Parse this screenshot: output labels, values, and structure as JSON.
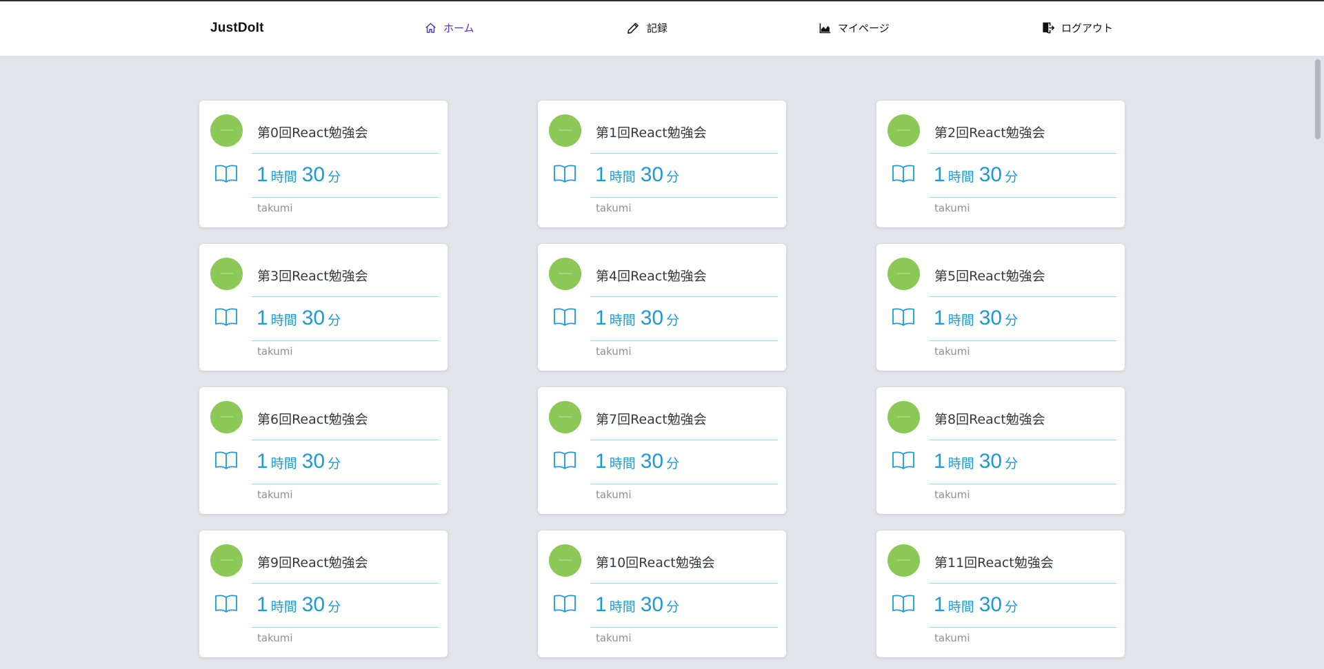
{
  "app": {
    "brand": "JustDoIt"
  },
  "nav": {
    "items": [
      {
        "label": "ホーム",
        "icon": "home-icon",
        "active": true
      },
      {
        "label": "記録",
        "icon": "pencil-icon",
        "active": false
      },
      {
        "label": "マイページ",
        "icon": "area-chart-icon",
        "active": false
      },
      {
        "label": "ログアウト",
        "icon": "logout-icon",
        "active": false
      }
    ]
  },
  "colors": {
    "accent_nav": "#4b2ec8",
    "duration_text": "#1a9ad6",
    "avatar_green": "#8cc856",
    "page_background": "#e2e4e9"
  },
  "cards": [
    {
      "title": "第0回React勉強会",
      "hours": "1",
      "hours_unit": "時間",
      "minutes": "30",
      "minutes_unit": "分",
      "user": "takumi"
    },
    {
      "title": "第1回React勉強会",
      "hours": "1",
      "hours_unit": "時間",
      "minutes": "30",
      "minutes_unit": "分",
      "user": "takumi"
    },
    {
      "title": "第2回React勉強会",
      "hours": "1",
      "hours_unit": "時間",
      "minutes": "30",
      "minutes_unit": "分",
      "user": "takumi"
    },
    {
      "title": "第3回React勉強会",
      "hours": "1",
      "hours_unit": "時間",
      "minutes": "30",
      "minutes_unit": "分",
      "user": "takumi"
    },
    {
      "title": "第4回React勉強会",
      "hours": "1",
      "hours_unit": "時間",
      "minutes": "30",
      "minutes_unit": "分",
      "user": "takumi"
    },
    {
      "title": "第5回React勉強会",
      "hours": "1",
      "hours_unit": "時間",
      "minutes": "30",
      "minutes_unit": "分",
      "user": "takumi"
    },
    {
      "title": "第6回React勉強会",
      "hours": "1",
      "hours_unit": "時間",
      "minutes": "30",
      "minutes_unit": "分",
      "user": "takumi"
    },
    {
      "title": "第7回React勉強会",
      "hours": "1",
      "hours_unit": "時間",
      "minutes": "30",
      "minutes_unit": "分",
      "user": "takumi"
    },
    {
      "title": "第8回React勉強会",
      "hours": "1",
      "hours_unit": "時間",
      "minutes": "30",
      "minutes_unit": "分",
      "user": "takumi"
    },
    {
      "title": "第9回React勉強会",
      "hours": "1",
      "hours_unit": "時間",
      "minutes": "30",
      "minutes_unit": "分",
      "user": "takumi"
    },
    {
      "title": "第10回React勉強会",
      "hours": "1",
      "hours_unit": "時間",
      "minutes": "30",
      "minutes_unit": "分",
      "user": "takumi"
    },
    {
      "title": "第11回React勉強会",
      "hours": "1",
      "hours_unit": "時間",
      "minutes": "30",
      "minutes_unit": "分",
      "user": "takumi"
    }
  ]
}
